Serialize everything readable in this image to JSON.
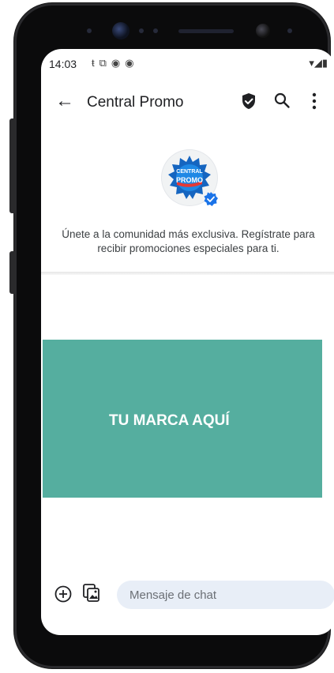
{
  "status_bar": {
    "time": "14:03",
    "icons": [
      "teams-icon",
      "screenshot-icon",
      "chrome-icon",
      "chrome-icon"
    ],
    "right": [
      "wifi-icon",
      "signal-icon",
      "battery-icon"
    ]
  },
  "app_bar": {
    "title": "Central Promo"
  },
  "profile": {
    "logo_line1": "CENTRAL",
    "logo_line2": "PROMO",
    "description": "Únete a la comunidad más exclusiva. Regístrate para recibir promociones especiales para ti."
  },
  "banner": {
    "text": "TU MARCA AQUÍ",
    "color": "#55ae9f"
  },
  "composer": {
    "placeholder": "Mensaje de chat"
  },
  "colors": {
    "accent": "#1a73e8",
    "logo_blue": "#1565c0"
  }
}
